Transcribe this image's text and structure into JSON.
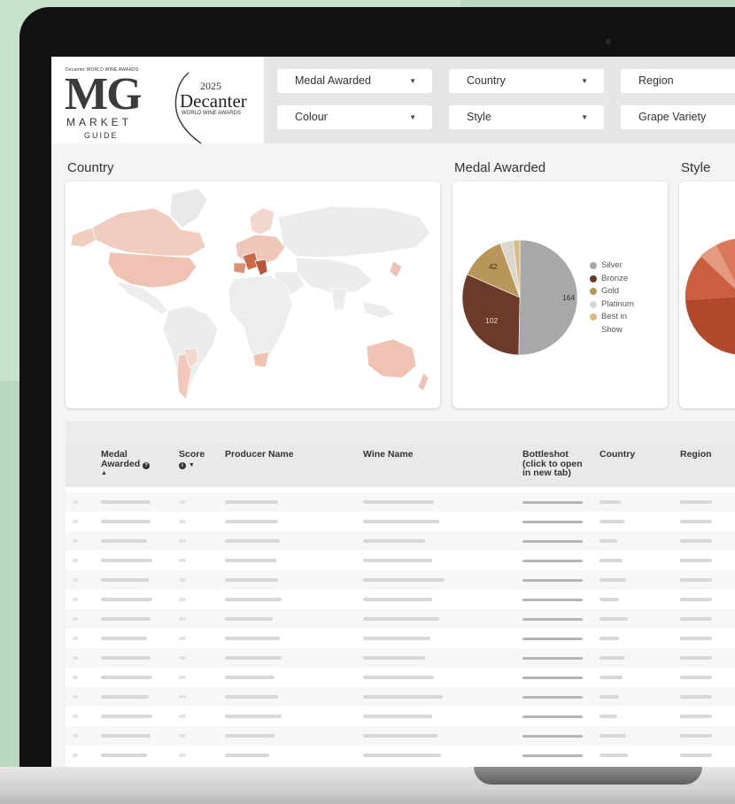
{
  "filters": {
    "medal": "Medal Awarded",
    "country": "Country",
    "region": "Region",
    "colour": "Colour",
    "style": "Style",
    "grape": "Grape Variety"
  },
  "logo": {
    "small_caption": "Decanter WORLD WINE AWARDS",
    "mg": "MG",
    "market": "MARKET",
    "guide": "GUIDE",
    "year": "2025",
    "decanter": "Decanter",
    "decanter_sub": "WORLD WINE AWARDS"
  },
  "sections": {
    "country": "Country",
    "medal": "Medal Awarded",
    "style": "Style"
  },
  "medal_chart": {
    "legend": [
      "Silver",
      "Bronze",
      "Gold",
      "Platinum",
      "Best in Show"
    ],
    "colors": [
      "#a8a8a8",
      "#6b3a2a",
      "#b8965a",
      "#dcd6cc",
      "#d6bd86"
    ],
    "labels": {
      "silver": "164",
      "bronze": "102",
      "gold": "42"
    }
  },
  "chart_data": {
    "type": "pie",
    "categories": [
      "Silver",
      "Bronze",
      "Gold",
      "Platinum",
      "Best in Show"
    ],
    "values": [
      164,
      102,
      42,
      12,
      6
    ]
  },
  "table": {
    "columns": {
      "medal": "Medal",
      "medal2": "Awarded",
      "score": "Score",
      "producer": "Producer Name",
      "wine": "Wine Name",
      "bottle1": "Bottleshot",
      "bottle2": "(click to open",
      "bottle3": "in new tab)",
      "country": "Country",
      "region": "Region"
    }
  }
}
